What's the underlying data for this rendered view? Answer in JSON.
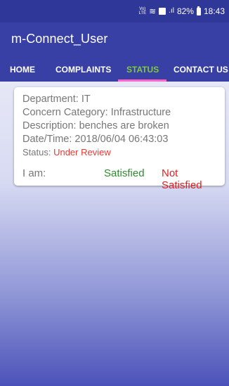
{
  "status_bar": {
    "battery_percent": "82%",
    "time": "18:43",
    "signal_label": "Vo) LTE",
    "signal_bars": ".ıl"
  },
  "app_bar": {
    "title": "m-Connect_User"
  },
  "tabs": [
    {
      "label": "HOME"
    },
    {
      "label": "COMPLAINTS"
    },
    {
      "label": "STATUS",
      "active": true
    },
    {
      "label": "CONTACT US"
    }
  ],
  "complaint": {
    "department": "Department: IT",
    "category": "Concern Category: Infrastructure",
    "description": "Description: benches are broken",
    "datetime": "Date/Time: 2018/06/04 06:43:03",
    "status_label": "Status: ",
    "status_value": "Under Review"
  },
  "feedback": {
    "label": "I am:",
    "satisfied": "Satisfied",
    "not_satisfied": "Not Satisfied"
  },
  "colors": {
    "status_bar": "#2f3799",
    "app_bar": "#3940a5",
    "tab_active": "#7ccb3a",
    "tab_indicator": "#ff66c4",
    "status_value": "#e53935",
    "satisfied": "#2e8b2e",
    "not_satisfied": "#e02020"
  }
}
